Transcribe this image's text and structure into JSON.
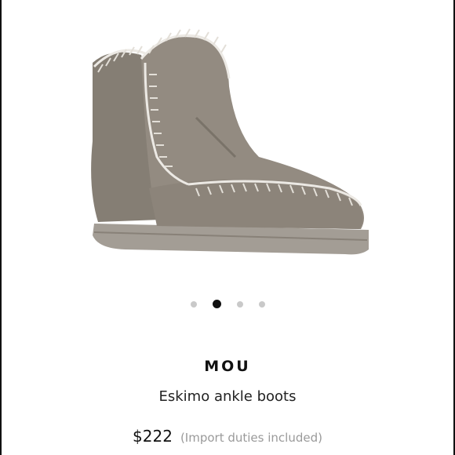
{
  "product": {
    "brand": "MOU",
    "title": "Eskimo ankle boots",
    "price": "$222",
    "duties_note": "(Import duties included)"
  },
  "carousel": {
    "total": 4,
    "active_index": 2
  },
  "colors": {
    "suede": "#8f877d",
    "stitch": "#e9e6e1",
    "sole": "#9b958e",
    "dot_active": "#111111",
    "dot_inactive": "#c9c9c9"
  }
}
